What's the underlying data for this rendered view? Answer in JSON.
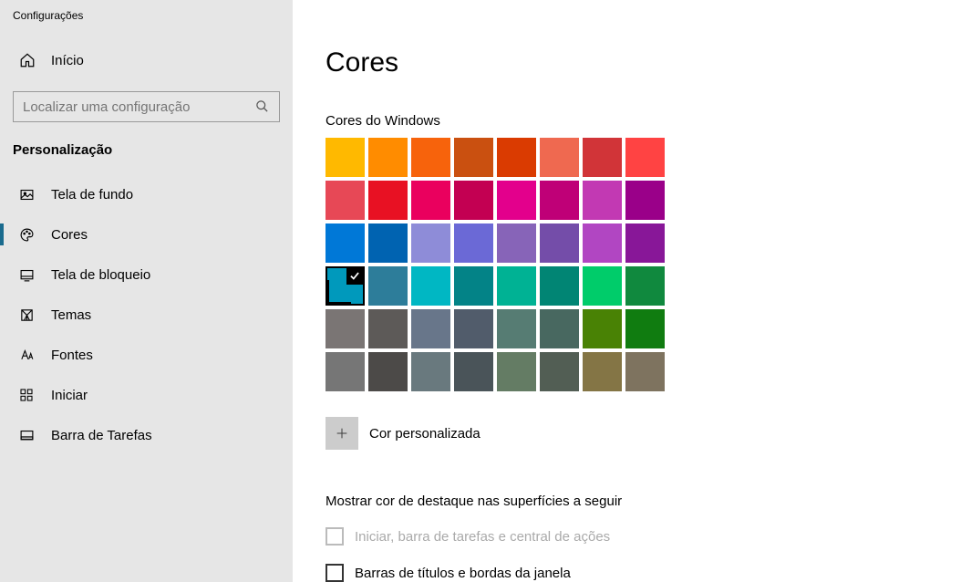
{
  "app_title": "Configurações",
  "home_label": "Início",
  "search": {
    "placeholder": "Localizar uma configuração"
  },
  "section_header": "Personalização",
  "nav": [
    {
      "label": "Tela de fundo",
      "icon": "picture",
      "active": false
    },
    {
      "label": "Cores",
      "icon": "palette",
      "active": true
    },
    {
      "label": "Tela de bloqueio",
      "icon": "lock-screen",
      "active": false
    },
    {
      "label": "Temas",
      "icon": "themes",
      "active": false
    },
    {
      "label": "Fontes",
      "icon": "fonts",
      "active": false
    },
    {
      "label": "Iniciar",
      "icon": "start",
      "active": false
    },
    {
      "label": "Barra de Tarefas",
      "icon": "taskbar",
      "active": false
    }
  ],
  "main": {
    "title": "Cores",
    "windows_colors_label": "Cores do Windows",
    "custom_color_label": "Cor personalizada",
    "accent_section_title": "Mostrar cor de destaque nas superfícies a seguir",
    "checkbox_start": "Iniciar, barra de tarefas e central de ações",
    "checkbox_titlebars": "Barras de títulos e bordas da janela"
  },
  "colors": [
    "#ffb900",
    "#ff8c00",
    "#f7630c",
    "#ca5010",
    "#da3b01",
    "#ef6950",
    "#d13438",
    "#ff4343",
    "#e74856",
    "#e81123",
    "#ea005e",
    "#c30052",
    "#e3008c",
    "#bf0077",
    "#c239b3",
    "#9a0089",
    "#0078d7",
    "#0063b1",
    "#8e8cd8",
    "#6b69d6",
    "#8764b8",
    "#744da9",
    "#b146c2",
    "#881798",
    "#0099bc",
    "#2d7d9a",
    "#00b7c3",
    "#038387",
    "#00b294",
    "#018574",
    "#00cc6a",
    "#10893e",
    "#7a7574",
    "#5d5a58",
    "#68768a",
    "#515c6b",
    "#567c73",
    "#486860",
    "#498205",
    "#107c10",
    "#767676",
    "#4c4a48",
    "#69797e",
    "#4a5459",
    "#647c64",
    "#525e54",
    "#847545",
    "#7e735f"
  ],
  "selected_color_index": 24
}
